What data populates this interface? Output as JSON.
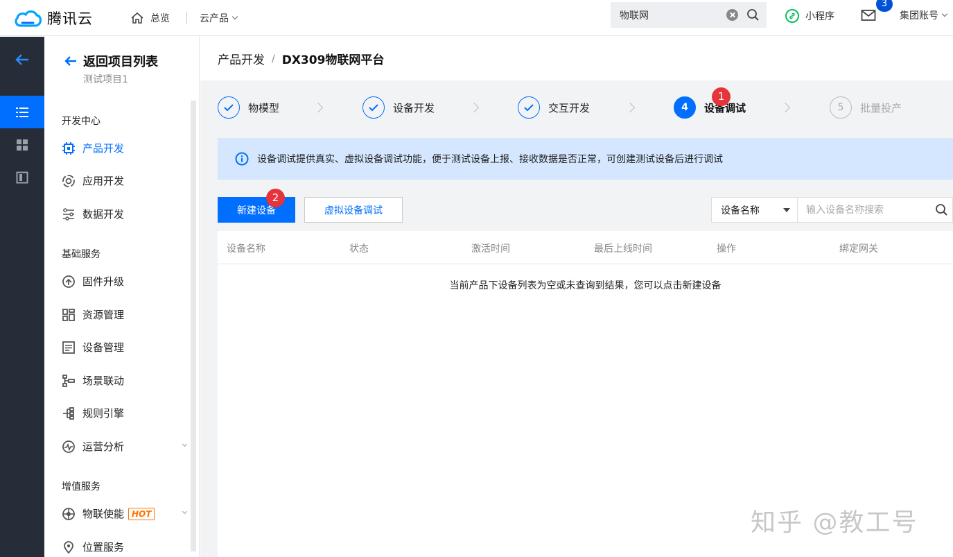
{
  "topbar": {
    "brand": "腾讯云",
    "nav": {
      "overview": "总览",
      "products": "云产品"
    },
    "search": {
      "value": "物联网"
    },
    "mini_program": "小程序",
    "mail_badge": "3",
    "account": "集团账号"
  },
  "sidebar": {
    "back_label": "返回项目列表",
    "project": "测试项目1",
    "groups": {
      "dev": "开发中心",
      "base": "基础服务",
      "value": "增值服务"
    },
    "items": {
      "product_dev": "产品开发",
      "app_dev": "应用开发",
      "data_dev": "数据开发",
      "firmware": "固件升级",
      "resource": "资源管理",
      "device_mgmt": "设备管理",
      "scene": "场景联动",
      "rule": "规则引擎",
      "ops": "运营分析",
      "iot_enable": "物联使能",
      "hot": "HOT",
      "location": "位置服务"
    }
  },
  "breadcrumb": {
    "parent": "产品开发",
    "separator": "/",
    "current": "DX309物联网平台"
  },
  "steps": [
    {
      "label": "物模型",
      "state": "done"
    },
    {
      "label": "设备开发",
      "state": "done"
    },
    {
      "label": "交互开发",
      "state": "done"
    },
    {
      "label": "设备调试",
      "num": "4",
      "state": "current"
    },
    {
      "label": "批量投产",
      "num": "5",
      "state": "pending"
    }
  ],
  "callouts": {
    "one": "1",
    "two": "2"
  },
  "notice": "设备调试提供真实、虚拟设备调试功能，便于测试设备上报、接收数据是否正常，可创建测试设备后进行调试",
  "toolbar": {
    "new_device": "新建设备",
    "virtual_debug": "虚拟设备调试",
    "filter_field": "设备名称",
    "search_placeholder": "输入设备名称搜索"
  },
  "table": {
    "columns": [
      "设备名称",
      "状态",
      "激活时间",
      "最后上线时间",
      "操作",
      "绑定网关"
    ],
    "empty_text": "当前产品下设备列表为空或未查询到结果，您可以点击新建设备"
  },
  "watermark": "知乎 @教工号",
  "colors": {
    "accent": "#006eff",
    "rail": "#262c38",
    "badge": "#e5343b",
    "notice_bg": "#d5e7ff",
    "hot": "#ff7200"
  }
}
